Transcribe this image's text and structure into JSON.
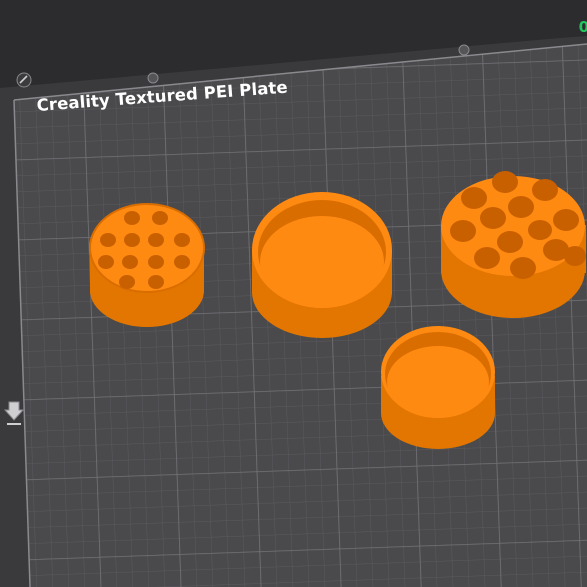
{
  "plate": {
    "name": "Creality Textured PEI Plate"
  },
  "corner_readout": "0",
  "colors": {
    "background": "#2c2c2e",
    "plate": "#4a4a4d",
    "grid_minor": "#5b5b5e",
    "grid_major": "#707074",
    "model": "#ff8a12",
    "model_shade": "#d96d00",
    "readout": "#22c55e"
  },
  "models": [
    {
      "name": "small-holder",
      "holes": 12
    },
    {
      "name": "large-lid",
      "holes": 0
    },
    {
      "name": "large-holder",
      "holes": 13
    },
    {
      "name": "small-lid",
      "holes": 0
    }
  ],
  "icons": [
    "edit-icon",
    "plate-pin-icon",
    "axis-marker-icon"
  ]
}
